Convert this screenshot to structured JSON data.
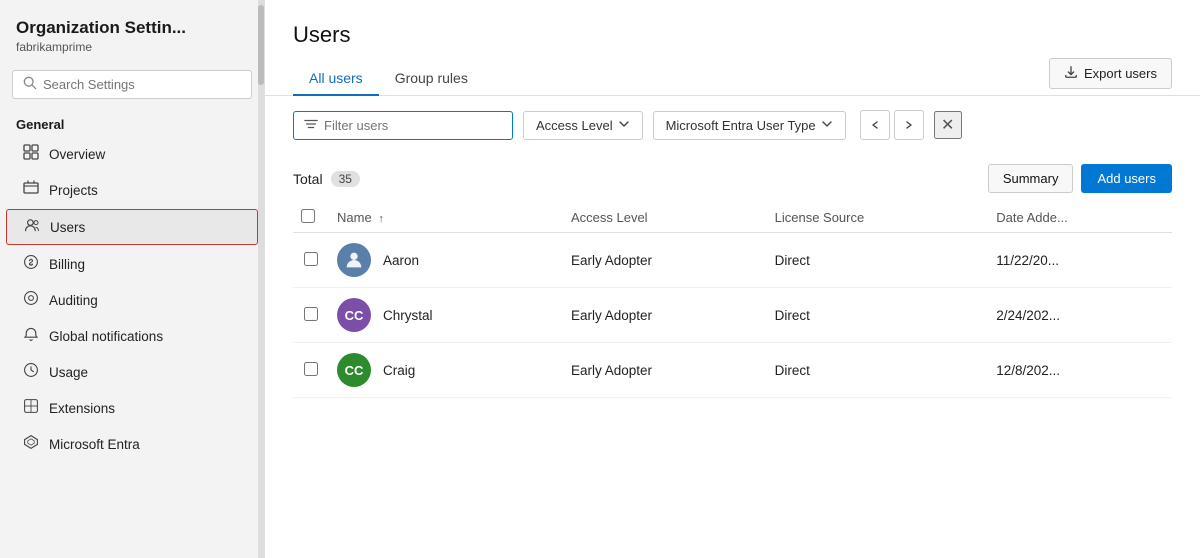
{
  "sidebar": {
    "title": "Organization Settin...",
    "subtitle": "fabrikamprime",
    "search_placeholder": "Search Settings",
    "section_label": "General",
    "items": [
      {
        "id": "overview",
        "label": "Overview",
        "icon": "⊞"
      },
      {
        "id": "projects",
        "label": "Projects",
        "icon": "⊕"
      },
      {
        "id": "users",
        "label": "Users",
        "icon": "👥",
        "active": true
      },
      {
        "id": "billing",
        "label": "Billing",
        "icon": "🛒"
      },
      {
        "id": "auditing",
        "label": "Auditing",
        "icon": "◎"
      },
      {
        "id": "global-notifications",
        "label": "Global notifications",
        "icon": "🔔"
      },
      {
        "id": "usage",
        "label": "Usage",
        "icon": "🔧"
      },
      {
        "id": "extensions",
        "label": "Extensions",
        "icon": "⊕"
      },
      {
        "id": "microsoft-entra",
        "label": "Microsoft Entra",
        "icon": "◆"
      }
    ]
  },
  "page": {
    "title": "Users",
    "tabs": [
      {
        "id": "all-users",
        "label": "All users",
        "active": true
      },
      {
        "id": "group-rules",
        "label": "Group rules",
        "active": false
      }
    ],
    "export_button": "Export users",
    "filter_placeholder": "Filter users",
    "access_level_label": "Access Level",
    "entra_user_type_label": "Microsoft Entra User Type",
    "total_label": "Total",
    "total_count": "35",
    "summary_button": "Summary",
    "add_users_button": "Add users",
    "table": {
      "columns": [
        {
          "id": "select",
          "label": ""
        },
        {
          "id": "name",
          "label": "Name",
          "sort": "↑"
        },
        {
          "id": "access_level",
          "label": "Access Level"
        },
        {
          "id": "license_source",
          "label": "License Source"
        },
        {
          "id": "date_added",
          "label": "Date Adde..."
        }
      ],
      "rows": [
        {
          "id": "aaron",
          "name": "Aaron",
          "avatar_initials": "",
          "avatar_type": "image",
          "avatar_color": "#5a7fa8",
          "access_level": "Early Adopter",
          "license_source": "Direct",
          "date_added": "11/22/20..."
        },
        {
          "id": "chrystal",
          "name": "Chrystal",
          "avatar_initials": "CC",
          "avatar_type": "initials",
          "avatar_color": "#7b4fa8",
          "access_level": "Early Adopter",
          "license_source": "Direct",
          "date_added": "2/24/202..."
        },
        {
          "id": "craig",
          "name": "Craig",
          "avatar_initials": "CC",
          "avatar_type": "initials",
          "avatar_color": "#2d8a2d",
          "access_level": "Early Adopter",
          "license_source": "Direct",
          "date_added": "12/8/202..."
        }
      ]
    }
  },
  "colors": {
    "active_tab": "#106ebe",
    "add_users_bg": "#0078d4",
    "sidebar_active_border": "#c0392b"
  }
}
